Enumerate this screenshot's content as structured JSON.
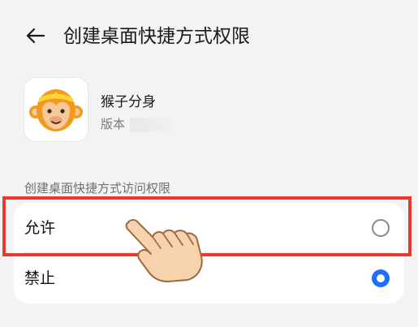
{
  "header": {
    "title": "创建桌面快捷方式权限",
    "back_icon": "back-arrow-icon"
  },
  "app": {
    "name": "猴子分身",
    "version_label": "版本",
    "version_value": ""
  },
  "section": {
    "label": "创建桌面快捷方式访问权限"
  },
  "options": [
    {
      "label": "允许",
      "selected": false
    },
    {
      "label": "禁止",
      "selected": true
    }
  ],
  "colors": {
    "accent": "#1f6fff",
    "highlight": "#ea3a30",
    "background": "#f1f3f5",
    "card": "#ffffff"
  }
}
